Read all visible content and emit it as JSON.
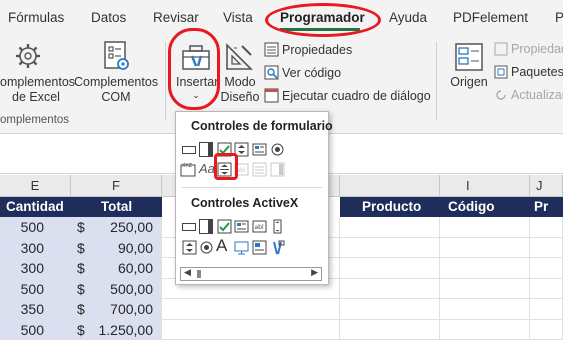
{
  "tabs": [
    "Fórmulas",
    "Datos",
    "Revisar",
    "Vista",
    "Programador",
    "Ayuda",
    "PDFelement",
    "P"
  ],
  "active_tab": "Programador",
  "ribbon": {
    "complementos_excel_label": "omplementos\nde Excel",
    "complementos_com_label": "Complementos\nCOM",
    "group_caption": "omplementos",
    "insertar_label": "Insertar",
    "modo_diseno_label": "Modo\nDiseño",
    "propiedades_label": "Propiedades",
    "ver_codigo_label": "Ver código",
    "ejecutar_label": "Ejecutar cuadro de diálogo",
    "origen_label": "Origen",
    "propiedad_right": "Propiedad",
    "paquetes_right": "Paquetes d",
    "actualizar_right": "Actualizar"
  },
  "dropdown": {
    "form_controls_title": "Controles de formulario",
    "activex_title": "Controles ActiveX",
    "activex_letter": "A",
    "form_italic_text": "Aa"
  },
  "columns": {
    "E": "E",
    "F": "F",
    "I": "I",
    "J": "J"
  },
  "headers": {
    "cantidad": "Cantidad",
    "total": "Total",
    "producto": "Producto",
    "codigo": "Código",
    "pr": "Pr"
  },
  "rows": [
    {
      "cantidad": "500",
      "currency": "$",
      "total": "250,00"
    },
    {
      "cantidad": "300",
      "currency": "$",
      "total": "90,00"
    },
    {
      "cantidad": "300",
      "currency": "$",
      "total": "60,00"
    },
    {
      "cantidad": "500",
      "currency": "$",
      "total": "500,00"
    },
    {
      "cantidad": "350",
      "currency": "$",
      "total": "700,00"
    },
    {
      "cantidad": "500",
      "currency": "$",
      "total": "1.250,00"
    }
  ],
  "colors": {
    "header_fill": "#1f2d5a",
    "selection_fill": "#dbe0f1",
    "annotation_red": "#e8191f",
    "excel_green": "#217346"
  }
}
